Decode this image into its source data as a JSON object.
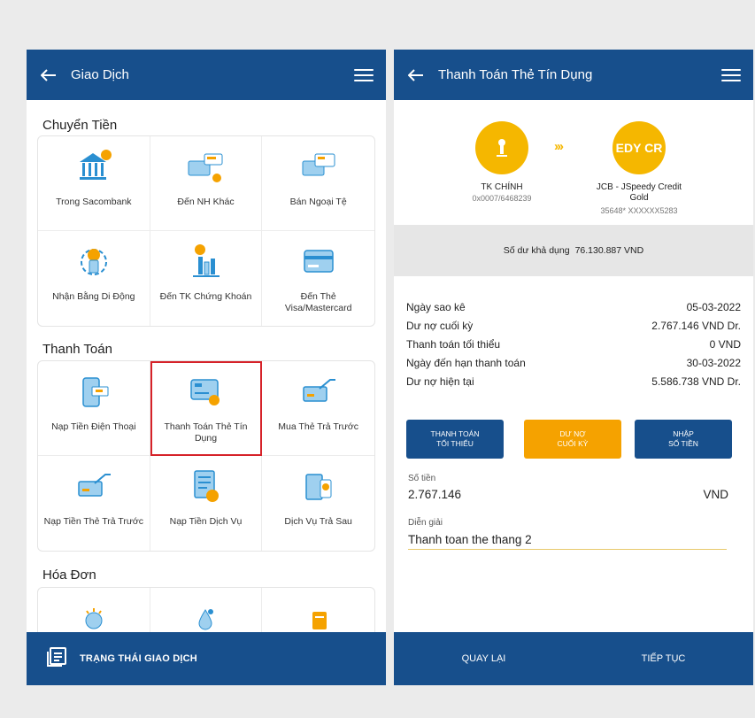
{
  "left": {
    "title": "Giao Dịch",
    "transfer": {
      "title": "Chuyển Tiền",
      "items": [
        {
          "label": "Trong Sacombank",
          "icon": "bank-transfer-icon"
        },
        {
          "label": "Đến NH Khác",
          "icon": "card-to-card-icon"
        },
        {
          "label": "Bán Ngoại Tệ",
          "icon": "foreign-currency-icon"
        },
        {
          "label": "Nhận Bằng Di Động",
          "icon": "mobile-receive-icon"
        },
        {
          "label": "Đến TK Chứng Khoán",
          "icon": "stock-account-icon"
        },
        {
          "label": "Đến Thẻ Visa/Mastercard",
          "icon": "visa-card-icon"
        }
      ]
    },
    "payment": {
      "title": "Thanh Toán",
      "items": [
        {
          "label": "Nạp Tiền Điện Thoại",
          "icon": "phone-topup-icon"
        },
        {
          "label": "Thanh Toán Thẻ Tín Dụng",
          "icon": "credit-card-payment-icon"
        },
        {
          "label": "Mua Thẻ Trả Trước",
          "icon": "prepaid-card-icon"
        },
        {
          "label": "Nạp Tiền Thẻ Trả Trước",
          "icon": "prepaid-topup-icon"
        },
        {
          "label": "Nạp Tiền Dịch Vụ",
          "icon": "service-topup-icon"
        },
        {
          "label": "Dịch Vụ Trả Sau",
          "icon": "postpaid-service-icon"
        }
      ]
    },
    "bills": {
      "title": "Hóa Đơn"
    },
    "bottom_label": "TRẠNG THÁI GIAO DỊCH"
  },
  "right": {
    "title": "Thanh Toán Thẻ Tín Dụng",
    "from_account": {
      "name": "TK CHÍNH",
      "number": "0x0007/6468239"
    },
    "to_card": {
      "name": "JCB - JSpeedy Credit Gold",
      "number": "35648* XXXXXX5283",
      "avatar_text": "EDY CR"
    },
    "balance_label": "Số dư khả dụng",
    "balance_value": "76.130.887 VND",
    "details": [
      {
        "label": "Ngày sao kê",
        "value": "05-03-2022"
      },
      {
        "label": "Dư nợ cuối kỳ",
        "value": "2.767.146 VND Dr."
      },
      {
        "label": "Thanh toán tối thiểu",
        "value": "0 VND"
      },
      {
        "label": "Ngày đến hạn thanh toán",
        "value": "30-03-2022"
      },
      {
        "label": "Dư nợ hiện tại",
        "value": "5.586.738 VND Dr."
      }
    ],
    "tabs": [
      {
        "line1": "THANH TOÁN",
        "line2": "TỐI THIỂU"
      },
      {
        "line1": "DƯ NỢ",
        "line2": "CUỐI KỲ"
      },
      {
        "line1": "NHẬP",
        "line2": "SỐ TIỀN"
      }
    ],
    "amount_label": "Số tiền",
    "amount_value": "2.767.146",
    "currency": "VND",
    "desc_label": "Diễn giải",
    "desc_value": "Thanh toan the thang 2",
    "back_button": "QUAY LẠI",
    "continue_button": "TIẾP TỤC"
  },
  "colors": {
    "primary": "#174f8c",
    "accent": "#f5a200",
    "highlight": "#d62229"
  }
}
